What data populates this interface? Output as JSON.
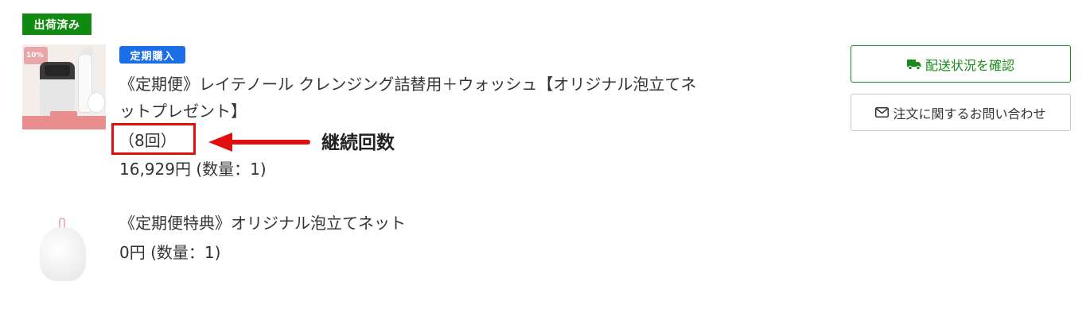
{
  "order": {
    "status_badge": "出荷済み",
    "items": [
      {
        "badge": "定期購入",
        "name": "《定期便》レイテノール クレンジング詰替用＋ウォッシュ【オリジナル泡立てネットプレゼント】",
        "count": "（8回）",
        "price": "16,929円 (数量：1)"
      },
      {
        "name": "《定期便特典》オリジナル泡立てネット",
        "price": "0円 (数量：1)"
      }
    ]
  },
  "annotation": {
    "label": "継続回数",
    "color": "#e01010"
  },
  "actions": {
    "shipping_label": "配送状況を確認",
    "shipping_icon": "truck-icon",
    "inquiry_label": "注文に関するお問い合わせ",
    "inquiry_icon": "envelope-icon"
  },
  "colors": {
    "shipped_badge": "#108a10",
    "subscription_badge": "#1a6fe8",
    "shipping_button": "#1a8a1a"
  }
}
